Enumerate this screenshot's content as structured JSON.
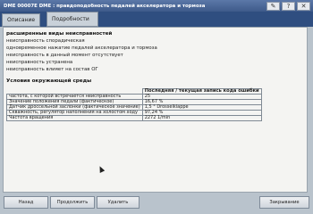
{
  "window": {
    "title": "DME 00007E DME : правдоподобность педалей акселератора и тормоза",
    "buttons": [
      "✎",
      "?",
      "✕"
    ]
  },
  "tabs": [
    "Описание",
    "Подробности"
  ],
  "details": {
    "heading": "расширенные виды неисправностей",
    "lines": [
      "неисправность спорадическая",
      "одновременное нажатие педалей акселератора и тормоза",
      "неисправность в данный момент отсутствует",
      "неисправность устранена",
      "неисправность влияет на состав ОГ"
    ]
  },
  "environment": {
    "heading": "Условия окружающей среды",
    "column_header": "Последняя / текущая запись кода ошибки",
    "rows": [
      {
        "label": "частота, с которой встречается неисправность",
        "value": "25"
      },
      {
        "label": "Значение положения педали (фактическое)",
        "value": "16,67 %"
      },
      {
        "label": "Датчик дроссельной заслонки (фактическое значение)",
        "value": "1,5 ° Drosselklappe"
      },
      {
        "label": "Скважность, регулятор наполнения на холостом ходу",
        "value": "97,24 %"
      },
      {
        "label": "Частота вращения",
        "value": "2272 1/min"
      }
    ]
  },
  "footer": {
    "back": "Назад",
    "continue": "Продолжить",
    "delete": "Удалить",
    "close": "Закрывание"
  }
}
